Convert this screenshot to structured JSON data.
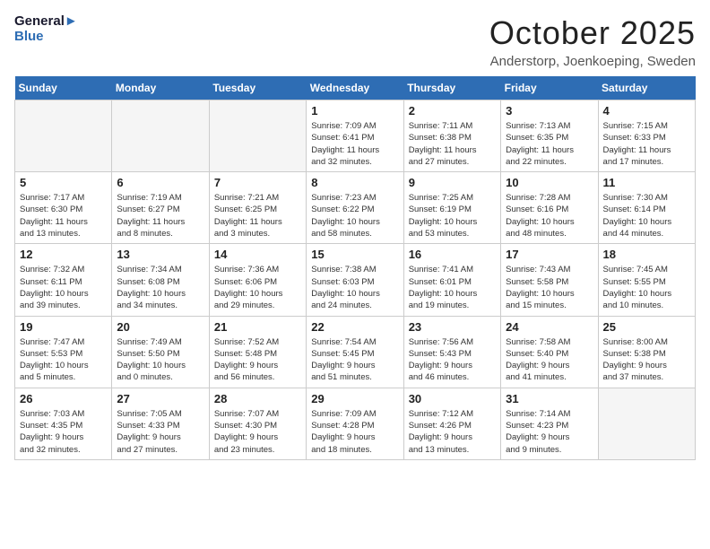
{
  "logo": {
    "line1": "General",
    "line2": "Blue"
  },
  "title": "October 2025",
  "subtitle": "Anderstorp, Joenkoeping, Sweden",
  "headers": [
    "Sunday",
    "Monday",
    "Tuesday",
    "Wednesday",
    "Thursday",
    "Friday",
    "Saturday"
  ],
  "weeks": [
    [
      {
        "day": "",
        "empty": true
      },
      {
        "day": "",
        "empty": true
      },
      {
        "day": "",
        "empty": true
      },
      {
        "day": "1",
        "info": "Sunrise: 7:09 AM\nSunset: 6:41 PM\nDaylight: 11 hours\nand 32 minutes."
      },
      {
        "day": "2",
        "info": "Sunrise: 7:11 AM\nSunset: 6:38 PM\nDaylight: 11 hours\nand 27 minutes."
      },
      {
        "day": "3",
        "info": "Sunrise: 7:13 AM\nSunset: 6:35 PM\nDaylight: 11 hours\nand 22 minutes."
      },
      {
        "day": "4",
        "info": "Sunrise: 7:15 AM\nSunset: 6:33 PM\nDaylight: 11 hours\nand 17 minutes."
      }
    ],
    [
      {
        "day": "5",
        "info": "Sunrise: 7:17 AM\nSunset: 6:30 PM\nDaylight: 11 hours\nand 13 minutes."
      },
      {
        "day": "6",
        "info": "Sunrise: 7:19 AM\nSunset: 6:27 PM\nDaylight: 11 hours\nand 8 minutes."
      },
      {
        "day": "7",
        "info": "Sunrise: 7:21 AM\nSunset: 6:25 PM\nDaylight: 11 hours\nand 3 minutes."
      },
      {
        "day": "8",
        "info": "Sunrise: 7:23 AM\nSunset: 6:22 PM\nDaylight: 10 hours\nand 58 minutes."
      },
      {
        "day": "9",
        "info": "Sunrise: 7:25 AM\nSunset: 6:19 PM\nDaylight: 10 hours\nand 53 minutes."
      },
      {
        "day": "10",
        "info": "Sunrise: 7:28 AM\nSunset: 6:16 PM\nDaylight: 10 hours\nand 48 minutes."
      },
      {
        "day": "11",
        "info": "Sunrise: 7:30 AM\nSunset: 6:14 PM\nDaylight: 10 hours\nand 44 minutes."
      }
    ],
    [
      {
        "day": "12",
        "info": "Sunrise: 7:32 AM\nSunset: 6:11 PM\nDaylight: 10 hours\nand 39 minutes."
      },
      {
        "day": "13",
        "info": "Sunrise: 7:34 AM\nSunset: 6:08 PM\nDaylight: 10 hours\nand 34 minutes."
      },
      {
        "day": "14",
        "info": "Sunrise: 7:36 AM\nSunset: 6:06 PM\nDaylight: 10 hours\nand 29 minutes."
      },
      {
        "day": "15",
        "info": "Sunrise: 7:38 AM\nSunset: 6:03 PM\nDaylight: 10 hours\nand 24 minutes."
      },
      {
        "day": "16",
        "info": "Sunrise: 7:41 AM\nSunset: 6:01 PM\nDaylight: 10 hours\nand 19 minutes."
      },
      {
        "day": "17",
        "info": "Sunrise: 7:43 AM\nSunset: 5:58 PM\nDaylight: 10 hours\nand 15 minutes."
      },
      {
        "day": "18",
        "info": "Sunrise: 7:45 AM\nSunset: 5:55 PM\nDaylight: 10 hours\nand 10 minutes."
      }
    ],
    [
      {
        "day": "19",
        "info": "Sunrise: 7:47 AM\nSunset: 5:53 PM\nDaylight: 10 hours\nand 5 minutes."
      },
      {
        "day": "20",
        "info": "Sunrise: 7:49 AM\nSunset: 5:50 PM\nDaylight: 10 hours\nand 0 minutes."
      },
      {
        "day": "21",
        "info": "Sunrise: 7:52 AM\nSunset: 5:48 PM\nDaylight: 9 hours\nand 56 minutes."
      },
      {
        "day": "22",
        "info": "Sunrise: 7:54 AM\nSunset: 5:45 PM\nDaylight: 9 hours\nand 51 minutes."
      },
      {
        "day": "23",
        "info": "Sunrise: 7:56 AM\nSunset: 5:43 PM\nDaylight: 9 hours\nand 46 minutes."
      },
      {
        "day": "24",
        "info": "Sunrise: 7:58 AM\nSunset: 5:40 PM\nDaylight: 9 hours\nand 41 minutes."
      },
      {
        "day": "25",
        "info": "Sunrise: 8:00 AM\nSunset: 5:38 PM\nDaylight: 9 hours\nand 37 minutes."
      }
    ],
    [
      {
        "day": "26",
        "info": "Sunrise: 7:03 AM\nSunset: 4:35 PM\nDaylight: 9 hours\nand 32 minutes."
      },
      {
        "day": "27",
        "info": "Sunrise: 7:05 AM\nSunset: 4:33 PM\nDaylight: 9 hours\nand 27 minutes."
      },
      {
        "day": "28",
        "info": "Sunrise: 7:07 AM\nSunset: 4:30 PM\nDaylight: 9 hours\nand 23 minutes."
      },
      {
        "day": "29",
        "info": "Sunrise: 7:09 AM\nSunset: 4:28 PM\nDaylight: 9 hours\nand 18 minutes."
      },
      {
        "day": "30",
        "info": "Sunrise: 7:12 AM\nSunset: 4:26 PM\nDaylight: 9 hours\nand 13 minutes."
      },
      {
        "day": "31",
        "info": "Sunrise: 7:14 AM\nSunset: 4:23 PM\nDaylight: 9 hours\nand 9 minutes."
      },
      {
        "day": "",
        "empty": true
      }
    ]
  ]
}
